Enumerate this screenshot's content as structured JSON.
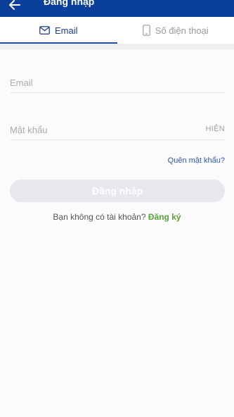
{
  "header": {
    "title": "Đăng nhập",
    "back_icon": "arrow-left-icon"
  },
  "tabs": [
    {
      "label": "Email",
      "icon": "envelope-icon",
      "active": true
    },
    {
      "label": "Số điện thoại",
      "icon": "phone-icon",
      "active": false
    }
  ],
  "form": {
    "email_placeholder": "Email",
    "password_placeholder": "Mật khẩu",
    "show_toggle_label": "HIỆN",
    "forgot_label": "Quên mật khẩu?",
    "submit_label": "Đăng nhập"
  },
  "signup": {
    "prompt": "Bạn không có tài khoản?",
    "link_label": "Đăng ký"
  },
  "colors": {
    "header_bg": "#0a3f9c",
    "active_tab": "#1d3e8a",
    "link_blue": "#2b58b5",
    "signup_green": "#5aa636",
    "button_disabled": "#e7e7ee"
  }
}
